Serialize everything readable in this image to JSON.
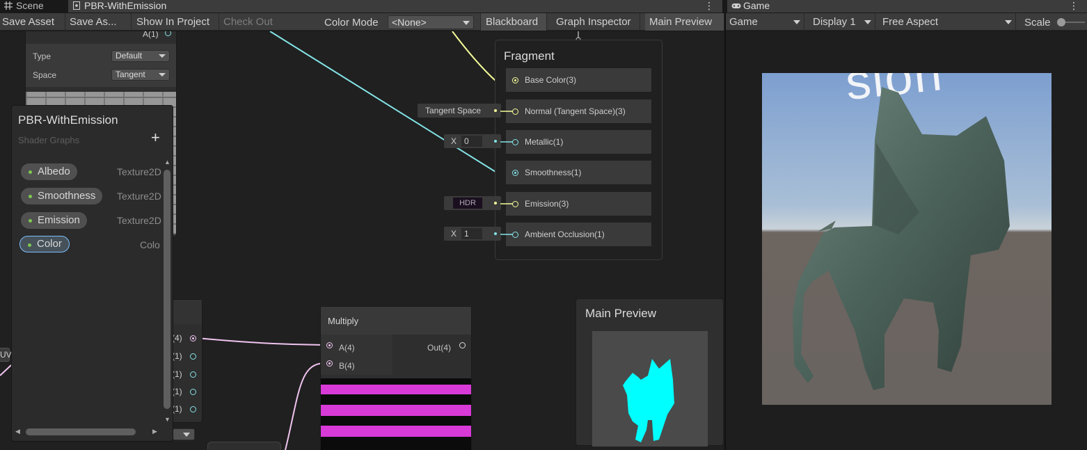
{
  "tabs": {
    "scene": "Scene",
    "graph": "PBR-WithEmission",
    "game": "Game"
  },
  "toolbar": {
    "save_asset": "Save Asset",
    "save_as": "Save As...",
    "show_in_project": "Show In Project",
    "check_out": "Check Out",
    "color_mode_label": "Color Mode",
    "color_mode_value": "<None>",
    "blackboard": "Blackboard",
    "graph_inspector": "Graph Inspector",
    "main_preview": "Main Preview"
  },
  "game_toolbar": {
    "view": "Game",
    "display": "Display 1",
    "aspect": "Free Aspect",
    "scale_label": "Scale"
  },
  "top_left_node": {
    "port_a": "A(1)",
    "type_label": "Type",
    "type_value": "Default",
    "space_label": "Space",
    "space_value": "Tangent"
  },
  "blackboard": {
    "title": "PBR-WithEmission",
    "subtitle": "Shader Graphs",
    "add": "+",
    "properties": [
      {
        "name": "Albedo",
        "type": "Texture2D"
      },
      {
        "name": "Smoothness",
        "type": "Texture2D"
      },
      {
        "name": "Emission",
        "type": "Texture2D"
      },
      {
        "name": "Color",
        "type": "Colo"
      }
    ]
  },
  "fragment": {
    "title": "Fragment",
    "slots": [
      {
        "label": "Base Color(3)",
        "color": "#f6ff9a"
      },
      {
        "label": "Normal (Tangent Space)(3)",
        "color": "#f6ff9a"
      },
      {
        "label": "Metallic(1)",
        "color": "#84e4e7"
      },
      {
        "label": "Smoothness(1)",
        "color": "#84e4e7"
      },
      {
        "label": "Emission(3)",
        "color": "#f6ff9a"
      },
      {
        "label": "Ambient Occlusion(1)",
        "color": "#84e4e7"
      }
    ],
    "inputs": {
      "tangent_space": "Tangent Space",
      "metallic_x": "X",
      "metallic_value": "0",
      "emission_hdr": "HDR",
      "ao_x": "X",
      "ao_value": "1"
    }
  },
  "split_node": {
    "ports": [
      "(4)",
      "(1)",
      "(1)",
      "(1)",
      "(1)"
    ]
  },
  "uv_label": "UV",
  "multiply": {
    "title": "Multiply",
    "in_a": "A(4)",
    "in_b": "B(4)",
    "out": "Out(4)"
  },
  "main_preview": {
    "title": "Main Preview"
  },
  "game_view": {
    "sky_text": "sion"
  },
  "colors": {
    "yellow_port": "#f6ff9a",
    "cyan_port": "#84e4e7",
    "pink_port": "#f0c4f0",
    "preview_cyan": "#00ffff",
    "stripe_magenta": "#d83ad8",
    "selection_blue": "#7bc0ff"
  }
}
